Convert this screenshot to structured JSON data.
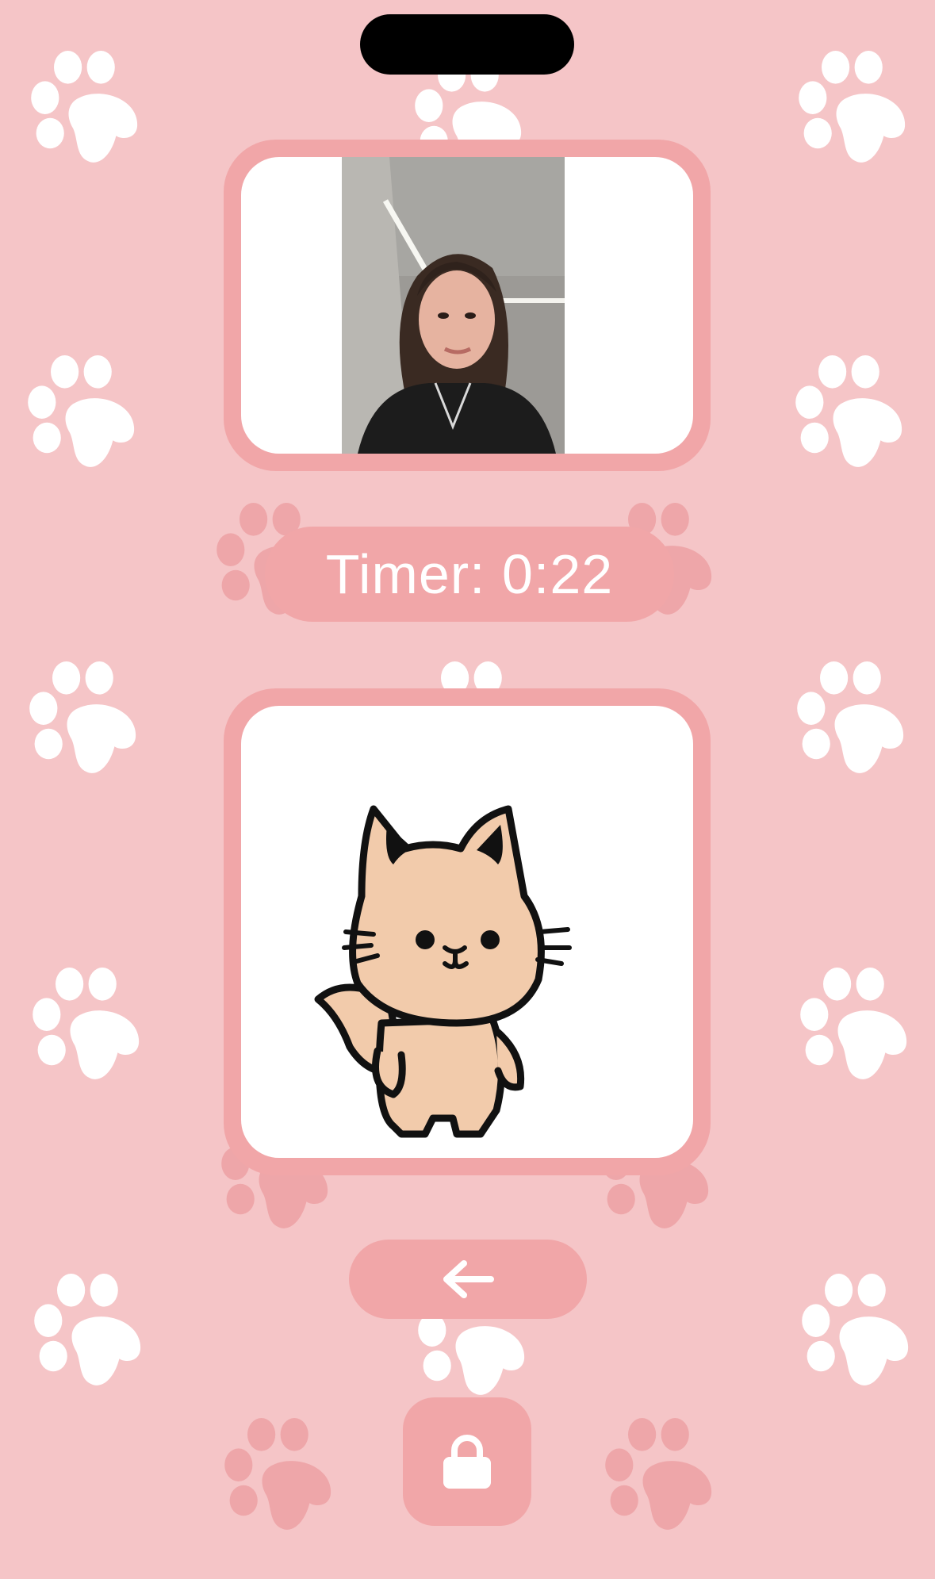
{
  "app": {
    "timer_text": "Timer: 0:22"
  },
  "camera": {
    "icon": "camera-preview"
  },
  "pet": {
    "icon": "cat-character"
  },
  "controls": {
    "back_icon": "arrow-left-icon",
    "lock_icon": "lock-icon"
  },
  "colors": {
    "background": "#f5c5c7",
    "accent": "#f1a6a8",
    "paw_white": "#ffffff",
    "paw_rose": "#eea6a9",
    "cat_fill": "#f2cbab"
  }
}
